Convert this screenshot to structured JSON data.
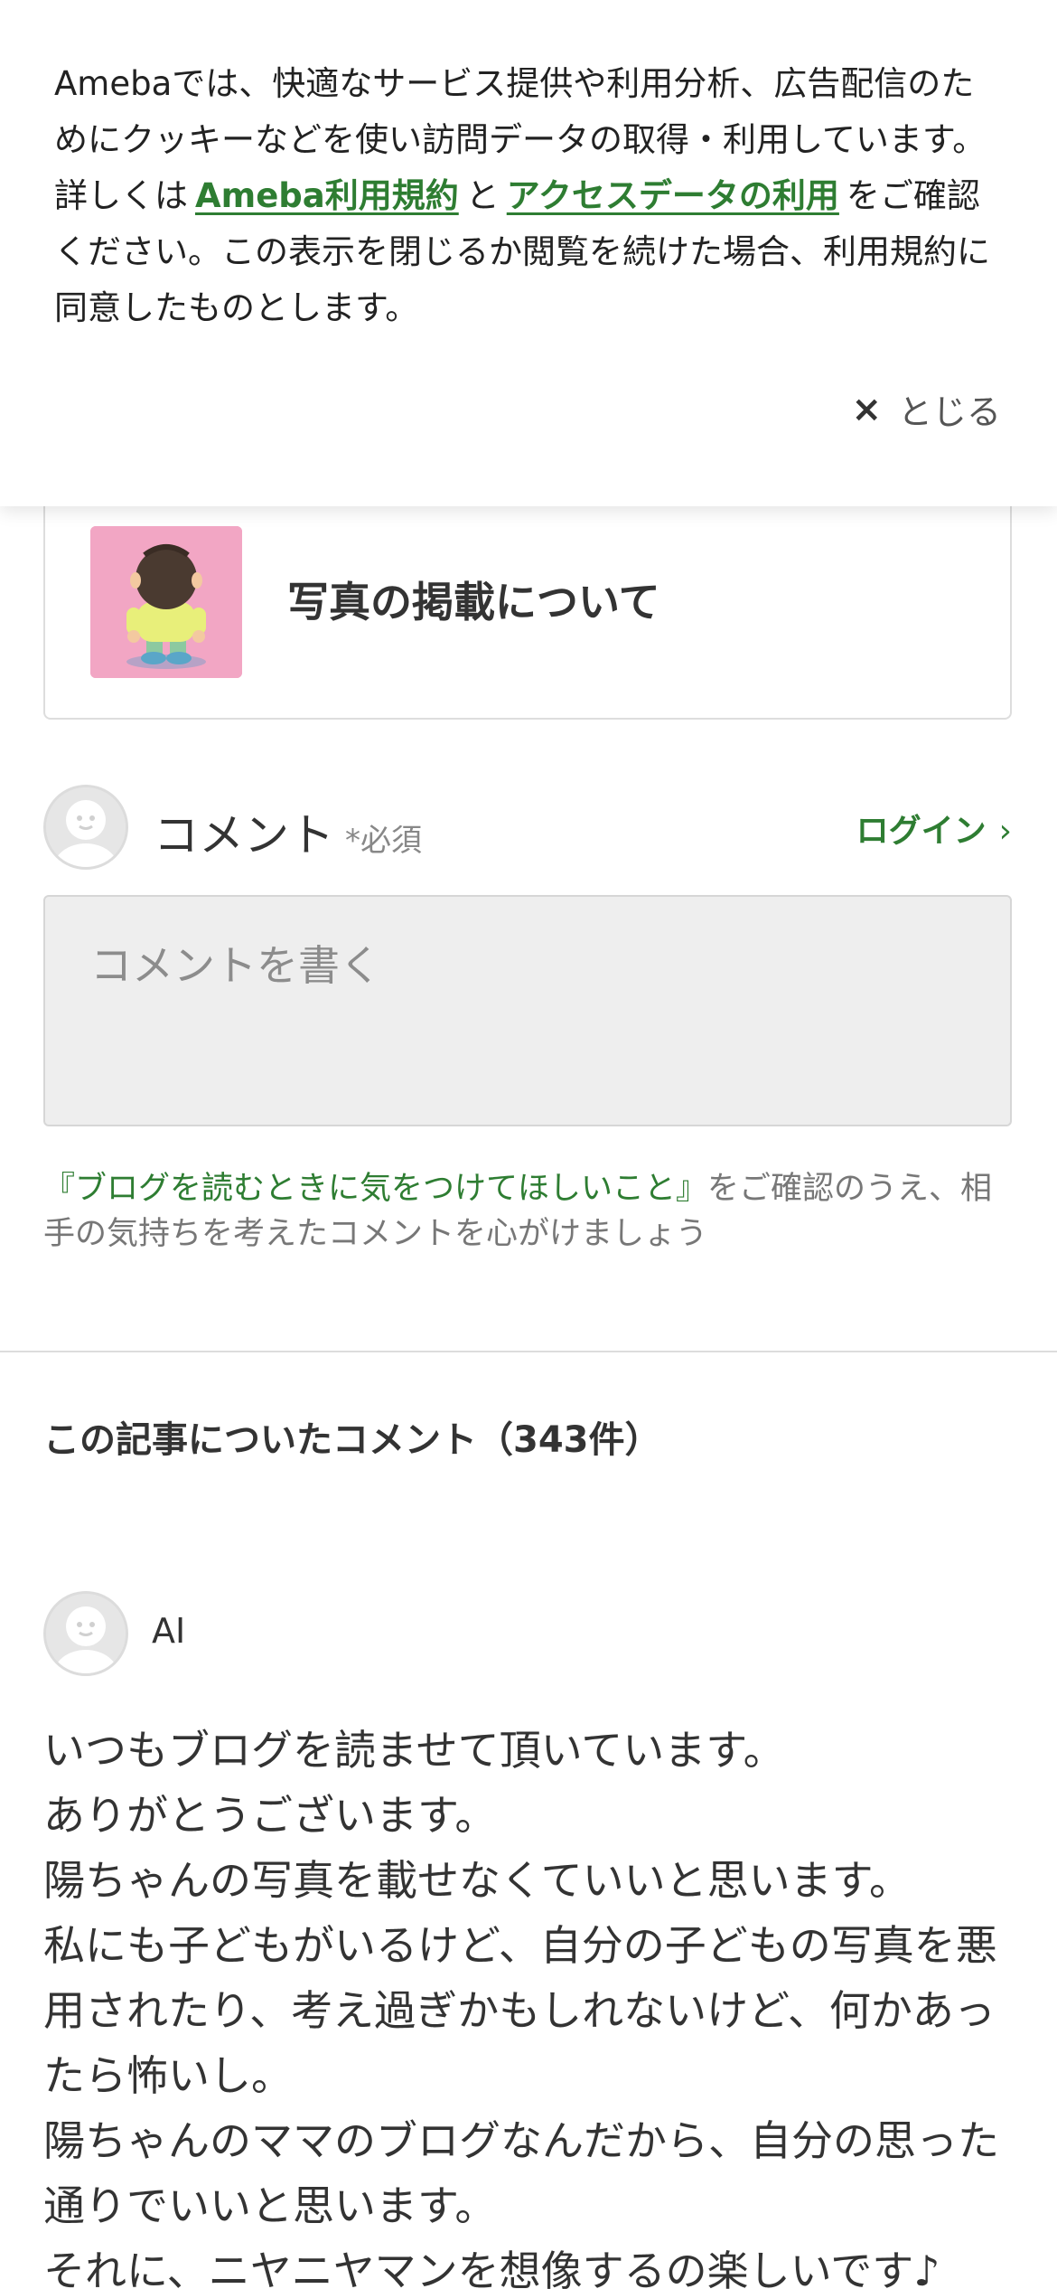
{
  "cookie_banner": {
    "text_before": "Amebaでは、快適なサービス提供や利用分析、広告配信のためにクッキーなどを使い訪問データの取得・利用しています。詳しくは",
    "link_terms": "Ameba利用規約",
    "text_and": "と",
    "link_access": "アクセスデータの利用",
    "text_after": "をご確認ください。この表示を閉じるか閲覧を続けた場合、利用規約に同意したものとします。",
    "close_label": "とじる",
    "close_icon": "×"
  },
  "related_article": {
    "title": "写真の掲載について"
  },
  "comment_form": {
    "label": "コメント",
    "required": "*必須",
    "login_label": "ログイン",
    "login_chevron": "›",
    "placeholder": "コメントを書く",
    "notice_link": "『ブログを読むときに気をつけてほしいこと』",
    "notice_text": "をご確認のうえ、相手の気持ちを考えたコメントを心がけましょう"
  },
  "comments_section": {
    "title": "この記事についたコメント（343件）"
  },
  "comments": [
    {
      "author": "AI",
      "body": "いつもブログを読ませて頂いています。\nありがとうございます。\n陽ちゃんの写真を載せなくていいと思います。\n私にも子どもがいるけど、自分の子どもの写真を悪用されたり、考え過ぎかもしれないけど、何かあったら怖いし。\n陽ちゃんのママのブログなんだから、自分の思った通りでいいと思います。\nそれに、ニヤニヤマンを想像するの楽しいです♪"
    }
  ],
  "colors": {
    "accent_green": "#2e7d32",
    "thumb_bg": "#f2a6c4",
    "input_bg": "#eeeeee"
  }
}
